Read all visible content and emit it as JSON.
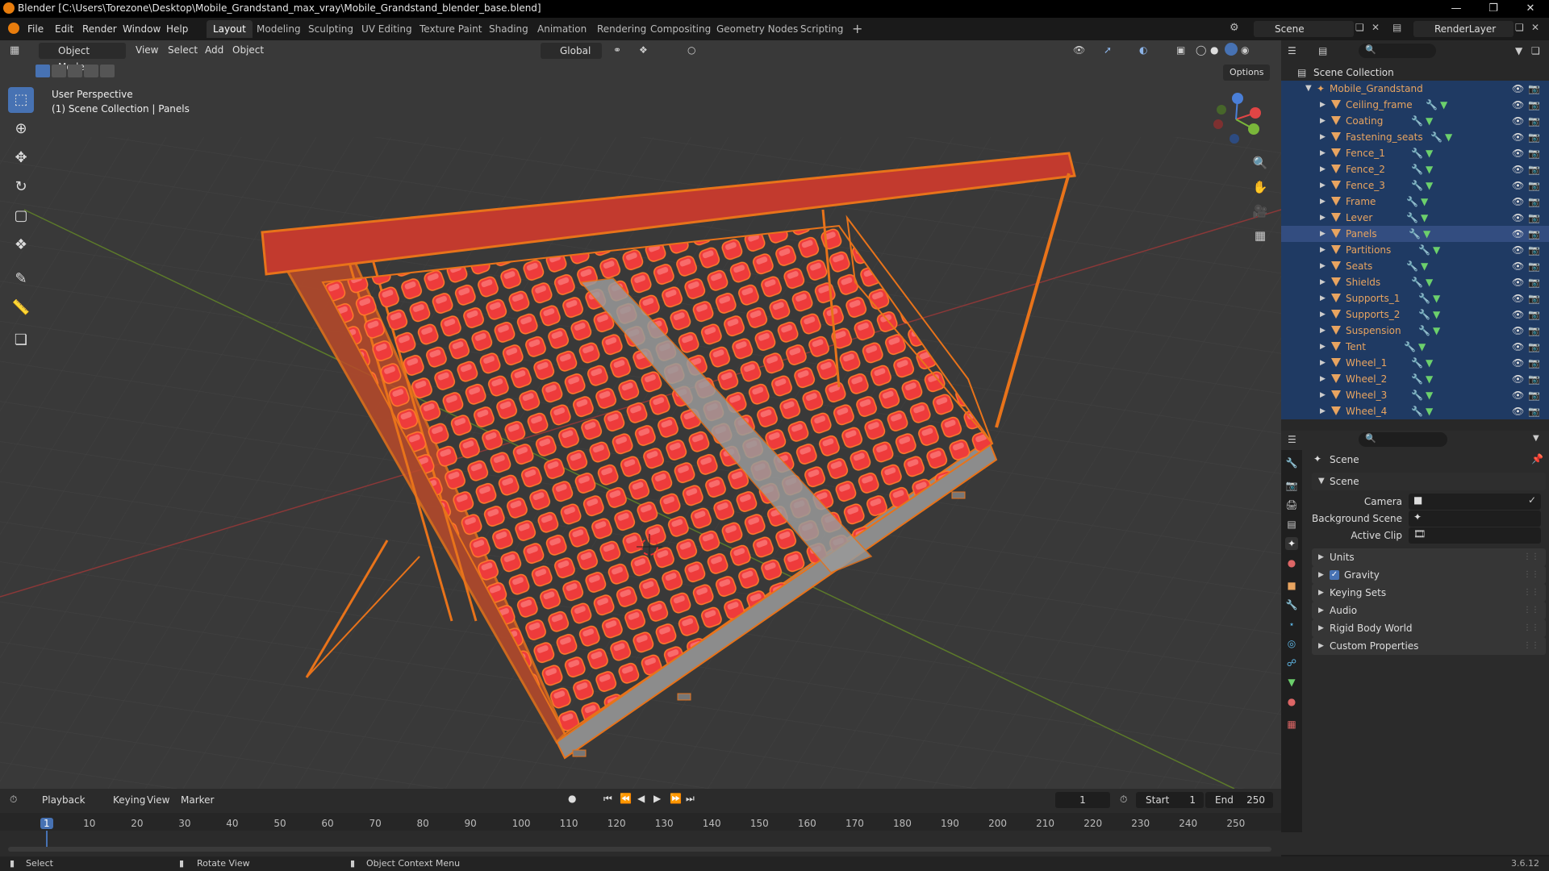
{
  "window": {
    "title": "Blender [C:\\Users\\Torezone\\Desktop\\Mobile_Grandstand_max_vray\\Mobile_Grandstand_blender_base.blend]"
  },
  "menu": [
    "File",
    "Edit",
    "Render",
    "Window",
    "Help"
  ],
  "workspaces": [
    "Layout",
    "Modeling",
    "Sculpting",
    "UV Editing",
    "Texture Paint",
    "Shading",
    "Animation",
    "Rendering",
    "Compositing",
    "Geometry Nodes",
    "Scripting"
  ],
  "scene_field": "Scene",
  "render_layer_field": "RenderLayer",
  "viewport": {
    "mode": "Object Mode",
    "menus": [
      "View",
      "Select",
      "Add",
      "Object"
    ],
    "orientation": "Global",
    "options": "Options",
    "overlay_line1": "User Perspective",
    "overlay_line2": "(1) Scene Collection | Panels"
  },
  "outliner": {
    "root": "Scene Collection",
    "collection": "Mobile_Grandstand",
    "objects": [
      "Ceiling_frame",
      "Coating",
      "Fastening_seats",
      "Fence_1",
      "Fence_2",
      "Fence_3",
      "Frame",
      "Lever",
      "Panels",
      "Partitions",
      "Seats",
      "Shields",
      "Supports_1",
      "Supports_2",
      "Suspension",
      "Tent",
      "Wheel_1",
      "Wheel_2",
      "Wheel_3",
      "Wheel_4"
    ],
    "selected": "Panels"
  },
  "properties": {
    "header": "Scene",
    "section": "Scene",
    "fields": [
      {
        "label": "Camera"
      },
      {
        "label": "Background Scene"
      },
      {
        "label": "Active Clip"
      }
    ],
    "panels": [
      "Units",
      "Gravity",
      "Keying Sets",
      "Audio",
      "Rigid Body World",
      "Custom Properties"
    ],
    "gravity_checked": true
  },
  "timeline": {
    "menus": [
      "Playback",
      "Keying",
      "View",
      "Marker"
    ],
    "current_frame": "1",
    "start_label": "Start",
    "start": "1",
    "end_label": "End",
    "end": "250",
    "ticks": [
      "1",
      "10",
      "20",
      "30",
      "40",
      "50",
      "60",
      "70",
      "80",
      "90",
      "100",
      "110",
      "120",
      "130",
      "140",
      "150",
      "160",
      "170",
      "180",
      "190",
      "200",
      "210",
      "220",
      "230",
      "240",
      "250"
    ]
  },
  "statusbar": {
    "select": "Select",
    "rotate": "Rotate View",
    "context": "Object Context Menu",
    "version": "3.6.12"
  },
  "colors": {
    "accent": "#4772b3",
    "object_name": "#e8a460",
    "selected_row": "#334d80",
    "outline": "#e8731a",
    "seat_red": "#e8373a"
  }
}
